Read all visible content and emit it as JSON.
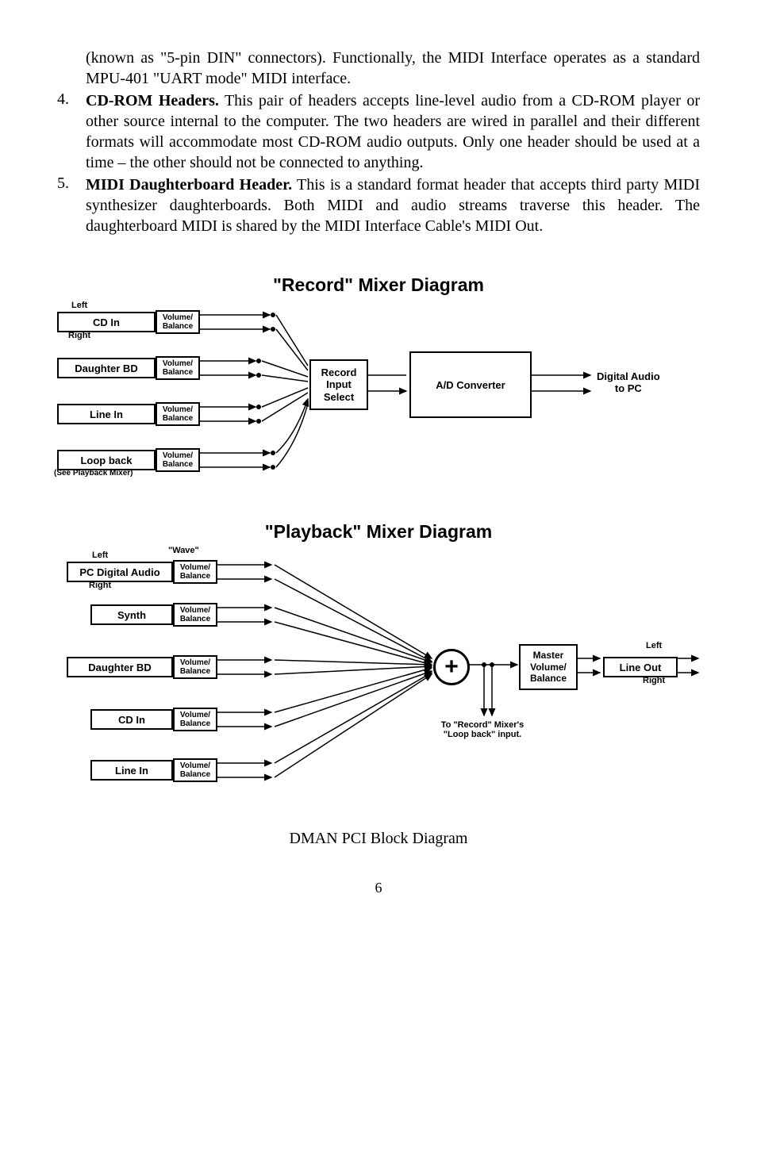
{
  "paragraphs": {
    "intro": "(known as \"5-pin DIN\" connectors).  Functionally, the MIDI Interface operates as a standard MPU-401 \"UART mode\" MIDI interface.",
    "item4_num": "4.",
    "item4_title": "CD-ROM Headers.",
    "item4_body": "  This pair of headers accepts line-level audio from a CD-ROM player or other source internal to the computer.  The two headers are wired in parallel and their different formats will accommodate most CD-ROM audio outputs.  Only one header should be used at a time – the other should not be connected to anything.",
    "item5_num": "5.",
    "item5_title": "MIDI Daughterboard Header.",
    "item5_body": "  This is a standard format header that accepts third party MIDI synthesizer daughterboards.  Both MIDI and audio streams traverse this header.  The daughterboard MIDI is shared by the MIDI Interface Cable's MIDI Out."
  },
  "record_diagram": {
    "title": "\"Record\" Mixer Diagram",
    "left": "Left",
    "right": "Right",
    "cd_in": "CD  In",
    "daughter": "Daughter BD",
    "line_in": "Line In",
    "loop_back": "Loop back",
    "loop_note": "(See Playback Mixer)",
    "vb_vol": "Volume/",
    "vb_bal": "Balance",
    "record_select_1": "Record",
    "record_select_2": "Input",
    "record_select_3": "Select",
    "ad": "A/D Converter",
    "out1": "Digital Audio",
    "out2": "to PC"
  },
  "playback_diagram": {
    "title": "\"Playback\" Mixer Diagram",
    "wave": "\"Wave\"",
    "left": "Left",
    "right": "Right",
    "pc_audio": "PC Digital Audio",
    "synth": "Synth",
    "daughter": "Daughter BD",
    "cd_in": "CD In",
    "line_in": "Line In",
    "vb_vol": "Volume/",
    "vb_bal": "Balance",
    "master1": "Master",
    "master2": "Volume/",
    "master3": "Balance",
    "line_out": "Line Out",
    "loop_note1": "To \"Record\" Mixer's",
    "loop_note2": "\"Loop back\" input.",
    "plus": "+"
  },
  "caption": "DMAN PCI Block Diagram",
  "page_number": "6"
}
